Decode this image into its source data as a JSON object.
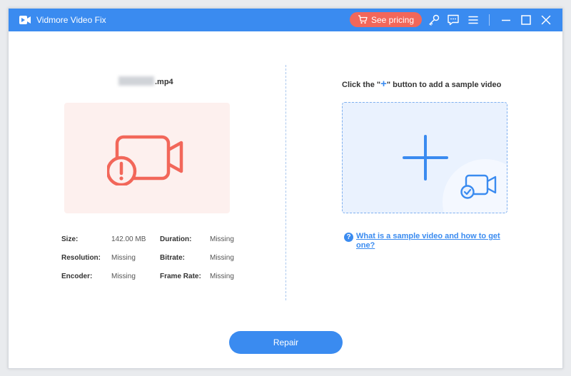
{
  "app": {
    "title": "Vidmore Video Fix"
  },
  "toolbar": {
    "pricing_label": "See pricing"
  },
  "icons": {
    "logo": "vidmore-logo-icon",
    "cart": "cart-icon",
    "key": "key-icon",
    "feedback": "chat-icon",
    "menu": "menu-icon",
    "minimize": "minimize-icon",
    "maximize": "maximize-icon",
    "close": "close-icon",
    "broken_video": "video-error-icon",
    "add": "plus-icon",
    "sample_video": "video-check-icon",
    "help": "question-icon"
  },
  "colors": {
    "accent": "#3a8bf0",
    "pricing": "#f2675a",
    "error": "#f2675a",
    "error_bg": "#fdf0ee",
    "drop_bg": "#eaf2fe"
  },
  "left_panel": {
    "file_name_suffix": ".mp4",
    "info": [
      {
        "label": "Size:",
        "value": "142.00 MB"
      },
      {
        "label": "Duration:",
        "value": "Missing"
      },
      {
        "label": "Resolution:",
        "value": "Missing"
      },
      {
        "label": "Bitrate:",
        "value": "Missing"
      },
      {
        "label": "Encoder:",
        "value": "Missing"
      },
      {
        "label": "Frame Rate:",
        "value": "Missing"
      }
    ]
  },
  "right_panel": {
    "title_prefix": "Click the \"",
    "title_plus": "+",
    "title_suffix": "\" button to add a sample video",
    "help_mark": "?",
    "help_link": "What is a sample video and how to get one?"
  },
  "actions": {
    "repair_label": "Repair"
  }
}
